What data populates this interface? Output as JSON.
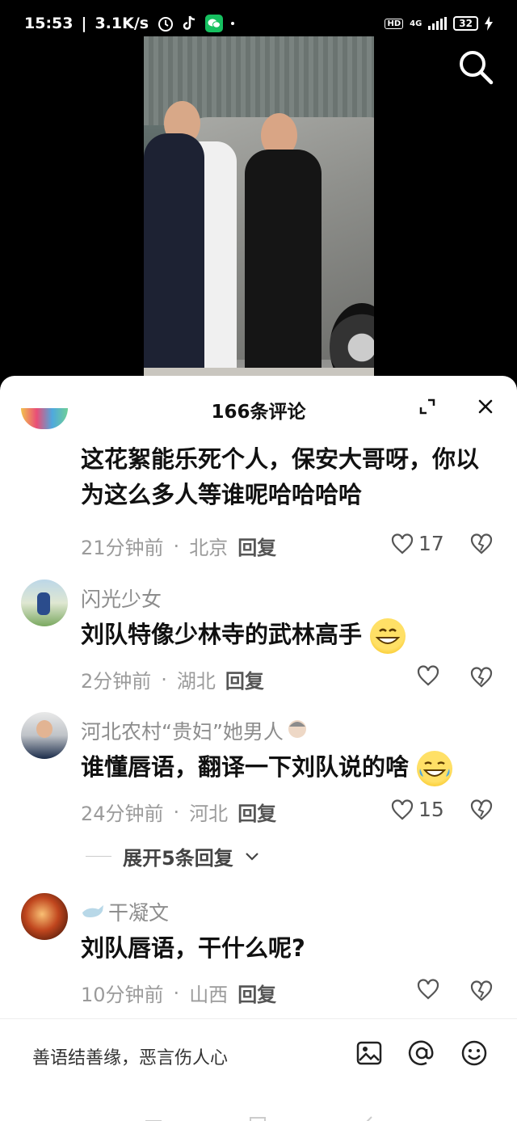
{
  "status_bar": {
    "time": "15:53",
    "speed": "3.1K/s",
    "hd": "HD",
    "network": "4G",
    "battery": "32"
  },
  "comments_header": {
    "title": "166条评论"
  },
  "comments": [
    {
      "name": "",
      "text": "这花絮能乐死个人，保安大哥呀，你以为这么多人等谁呢哈哈哈哈",
      "time": "21分钟前",
      "location": "北京",
      "reply": "回复",
      "likes": "17"
    },
    {
      "name": "闪光少女",
      "text": "刘队特像少林寺的武林高手",
      "time": "2分钟前",
      "location": "湖北",
      "reply": "回复",
      "likes": ""
    },
    {
      "name": "河北农村“贵妇”她男人",
      "text": "谁懂唇语，翻译一下刘队说的啥",
      "time": "24分钟前",
      "location": "河北",
      "reply": "回复",
      "likes": "15",
      "expand_replies": "展开5条回复"
    },
    {
      "name": "干凝文",
      "text": "刘队唇语，干什么呢?",
      "time": "10分钟前",
      "location": "山西",
      "reply": "回复",
      "likes": ""
    }
  ],
  "input_bar": {
    "placeholder": "善语结善缘，恶言伤人心"
  },
  "icons": {
    "search": "search-icon",
    "expand": "expand-icon",
    "close": "close-icon",
    "like": "heart-icon",
    "dislike": "broken-heart-icon",
    "image": "image-icon",
    "mention": "at-icon",
    "emoji": "emoji-icon"
  }
}
